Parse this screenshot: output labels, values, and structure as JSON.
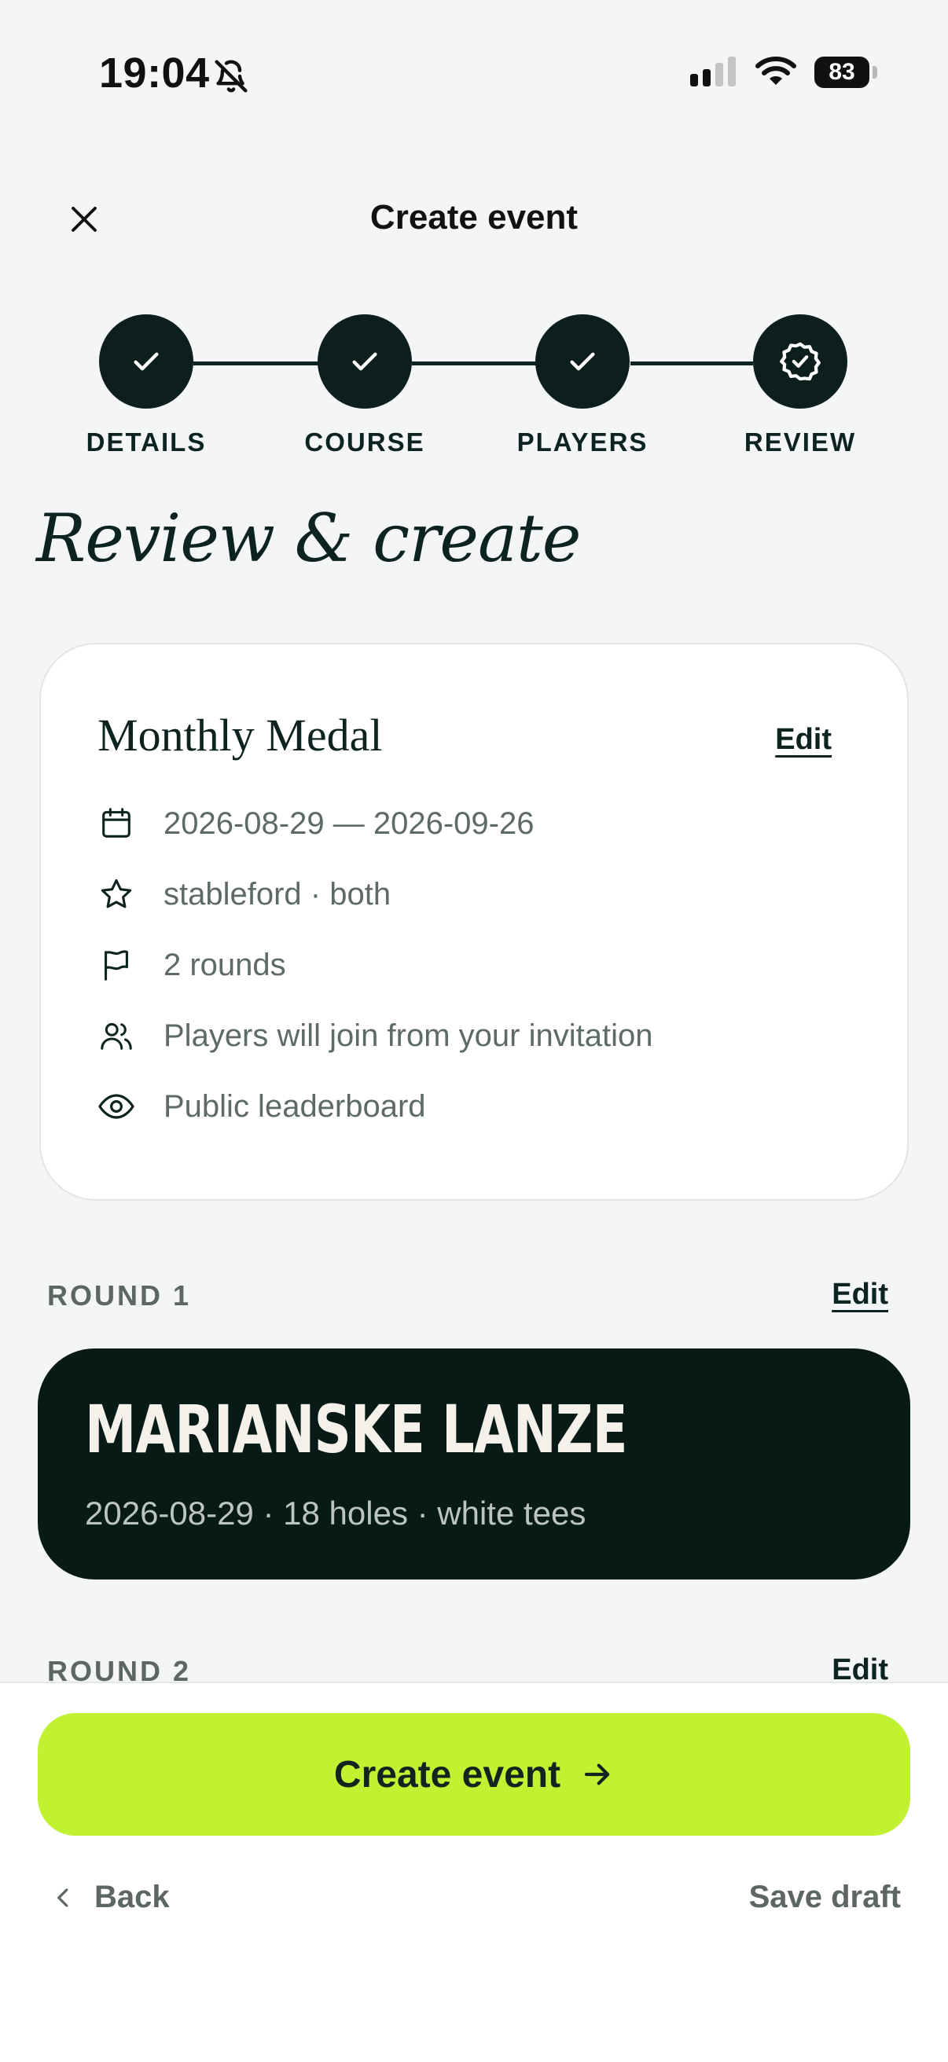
{
  "status_bar": {
    "time": "19:04",
    "battery": "83",
    "icons": [
      "bell-slash-icon",
      "cellular-signal-icon",
      "wifi-icon",
      "battery-icon"
    ]
  },
  "header": {
    "title": "Create event",
    "close_icon": "close-icon"
  },
  "stepper": {
    "steps": [
      {
        "label": "DETAILS",
        "state": "complete",
        "icon": "check-icon"
      },
      {
        "label": "COURSE",
        "state": "complete",
        "icon": "check-icon"
      },
      {
        "label": "PLAYERS",
        "state": "complete",
        "icon": "check-icon"
      },
      {
        "label": "REVIEW",
        "state": "current",
        "icon": "badge-check-icon"
      }
    ]
  },
  "page": {
    "title": "Review & create"
  },
  "summary": {
    "event_name": "Monthly Medal",
    "edit_label": "Edit",
    "details": [
      {
        "icon": "calendar-icon",
        "text": "2026-08-29 — 2026-09-26"
      },
      {
        "icon": "star-icon",
        "text": "stableford · both"
      },
      {
        "icon": "flag-icon",
        "text": "2 rounds"
      },
      {
        "icon": "users-icon",
        "text": "Players will join from your invitation"
      },
      {
        "icon": "eye-icon",
        "text": "Public leaderboard"
      }
    ]
  },
  "rounds": [
    {
      "label": "ROUND 1",
      "edit_label": "Edit",
      "course": "MARIANSKE LANZE",
      "meta": "2026-08-29 · 18 holes · white tees"
    },
    {
      "label": "ROUND 2",
      "edit_label": "Edit"
    }
  ],
  "footer": {
    "create_label": "Create event",
    "back_label": "Back",
    "save_draft_label": "Save draft"
  },
  "colors": {
    "background": "#f3f5f7",
    "dark": "#0c1f1c",
    "accent": "#c0f232",
    "muted_text": "#5d6a68"
  }
}
